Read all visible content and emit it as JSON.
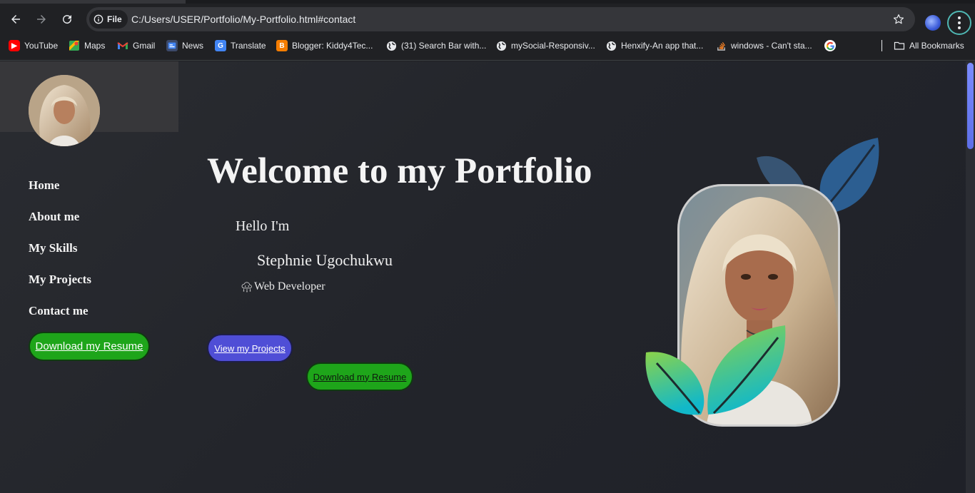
{
  "browser": {
    "url": "C:/Users/USER/Portfolio/My-Portfolio.html#contact",
    "site_chip": "File",
    "nav": {
      "back_icon": "arrow-left-icon",
      "forward_icon": "arrow-right-icon",
      "reload_icon": "reload-icon"
    }
  },
  "bookmarks": [
    {
      "label": "YouTube",
      "icon": "youtube-icon",
      "color": "#ff0000"
    },
    {
      "label": "Maps",
      "icon": "maps-icon",
      "color": "#34a853"
    },
    {
      "label": "Gmail",
      "icon": "gmail-icon",
      "color": "#ea4335"
    },
    {
      "label": "News",
      "icon": "news-icon",
      "color": "#4285f4"
    },
    {
      "label": "Translate",
      "icon": "translate-icon",
      "color": "#4285f4"
    },
    {
      "label": "Blogger: Kiddy4Tec...",
      "icon": "blogger-icon",
      "color": "#f57d00"
    },
    {
      "label": "(31) Search Bar with...",
      "icon": "globe-icon",
      "color": "#e8eaed"
    },
    {
      "label": "mySocial-Responsiv...",
      "icon": "globe-icon",
      "color": "#e8eaed"
    },
    {
      "label": "Henxify-An app that...",
      "icon": "globe-icon",
      "color": "#e8eaed"
    },
    {
      "label": "windows - Can't sta...",
      "icon": "stackoverflow-icon",
      "color": "#f48024"
    },
    {
      "label": "",
      "icon": "google-icon",
      "color": "#4285f4"
    }
  ],
  "all_bookmarks": "All Bookmarks",
  "sidebar": {
    "items": [
      {
        "label": "Home"
      },
      {
        "label": "About me"
      },
      {
        "label": "My Skills"
      },
      {
        "label": "My Projects"
      },
      {
        "label": "Contact me"
      }
    ],
    "resume_button": "Download my Resume"
  },
  "hero": {
    "title": "Welcome to my Portfolio",
    "greeting": "Hello I'm",
    "name": "Stephnie Ugochukwu",
    "role": "Web Developer",
    "projects_button": "View my Projects",
    "resume_button": "Download my Resume"
  },
  "colors": {
    "accent_green": "#1ea51a",
    "accent_blue": "#4f4ed6",
    "leaf_blue": "#2c5e91",
    "leaf_gradient_top": "#8bd34a",
    "leaf_gradient_bottom": "#11b8c9"
  }
}
